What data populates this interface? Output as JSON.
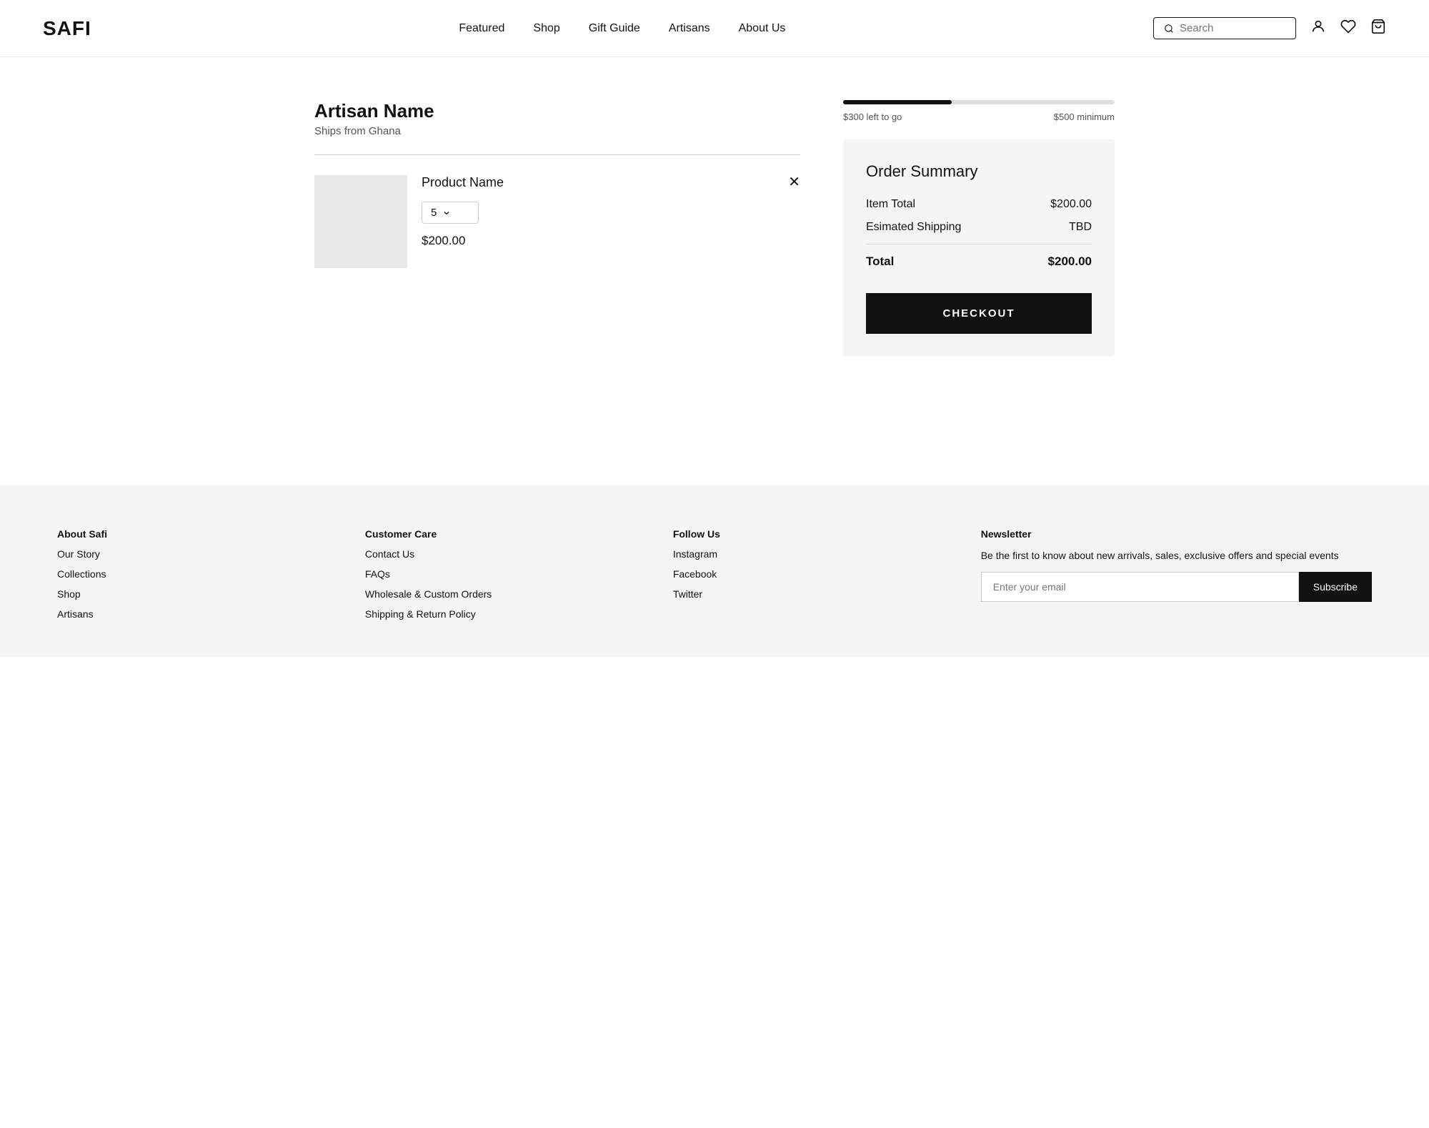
{
  "header": {
    "logo": "SAFI",
    "nav": [
      {
        "label": "Featured",
        "href": "#"
      },
      {
        "label": "Shop",
        "href": "#"
      },
      {
        "label": "Gift Guide",
        "href": "#"
      },
      {
        "label": "Artisans",
        "href": "#"
      },
      {
        "label": "About Us",
        "href": "#"
      }
    ],
    "search_placeholder": "Search"
  },
  "cart": {
    "artisan_name": "Artisan Name",
    "ships_from": "Ships from Ghana",
    "item": {
      "name": "Product Name",
      "quantity": "5",
      "price": "$200.00"
    },
    "progress": {
      "left_to_go": "$300 left to go",
      "minimum": "$500 minimum",
      "fill_percent": 40
    },
    "order_summary": {
      "title": "Order Summary",
      "item_total_label": "Item Total",
      "item_total_value": "$200.00",
      "shipping_label": "Esimated Shipping",
      "shipping_value": "TBD",
      "total_label": "Total",
      "total_value": "$200.00",
      "checkout_label": "CHECKOUT"
    }
  },
  "footer": {
    "about": {
      "title": "About Safi",
      "links": [
        "Our Story",
        "Collections",
        "Shop",
        "Artisans"
      ]
    },
    "customer_care": {
      "title": "Customer Care",
      "links": [
        "Contact Us",
        "FAQs",
        "Wholesale & Custom Orders",
        "Shipping & Return Policy"
      ]
    },
    "follow_us": {
      "title": "Follow Us",
      "links": [
        "Instagram",
        "Facebook",
        "Twitter"
      ]
    },
    "newsletter": {
      "title": "Newsletter",
      "description": "Be the first to know about new arrivals, sales, exclusive offers and special events",
      "input_placeholder": "Enter your email",
      "button_label": "Subscribe"
    }
  }
}
